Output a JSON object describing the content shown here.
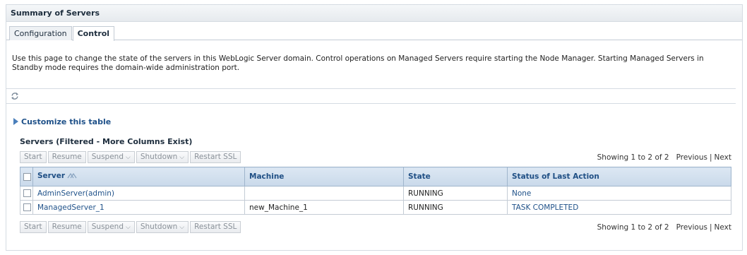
{
  "page": {
    "title": "Summary of Servers"
  },
  "tabs": [
    {
      "label": "Configuration",
      "active": false
    },
    {
      "label": "Control",
      "active": true
    }
  ],
  "description": "Use this page to change the state of the servers in this WebLogic Server domain. Control operations on Managed Servers require starting the Node Manager. Starting Managed Servers in Standby mode requires the domain-wide administration port.",
  "refresh": {
    "icon": "refresh-icon"
  },
  "customize_label": "Customize this table",
  "table": {
    "title": "Servers (Filtered - More Columns Exist)",
    "buttons": {
      "start": "Start",
      "resume": "Resume",
      "suspend": "Suspend",
      "shutdown": "Shutdown",
      "restart_ssl": "Restart SSL"
    },
    "pager": {
      "showing": "Showing 1 to 2 of 2",
      "previous": "Previous",
      "separator": "|",
      "next": "Next"
    },
    "columns": {
      "server": "Server",
      "machine": "Machine",
      "state": "State",
      "status": "Status of Last Action"
    },
    "rows": [
      {
        "server": "AdminServer(admin)",
        "machine": "",
        "state": "RUNNING",
        "status": "None"
      },
      {
        "server": "ManagedServer_1",
        "machine": "new_Machine_1",
        "state": "RUNNING",
        "status": "TASK COMPLETED"
      }
    ]
  },
  "colors": {
    "link": "#1f5189",
    "header_bg": "#c9d9ea",
    "disabled_button_text": "#8a9199"
  }
}
